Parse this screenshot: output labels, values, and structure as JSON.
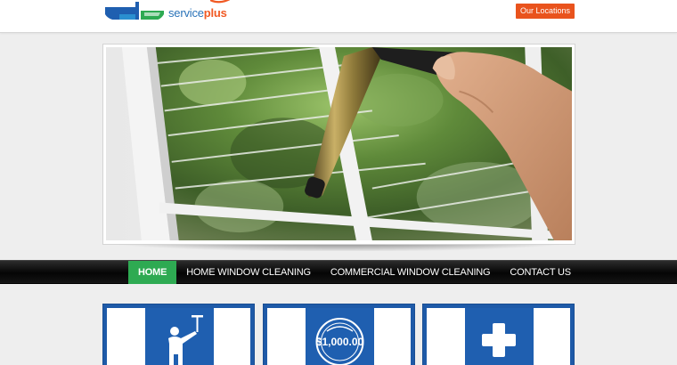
{
  "brand": {
    "name_part1": "service",
    "name_part2": "plus",
    "primary_color": "#2a73b8",
    "accent_color": "#f15a24",
    "green_color": "#2eaa52"
  },
  "header": {
    "locations_button": "Our Locations"
  },
  "hero": {
    "image": "window-cleaning-squeegee-photo"
  },
  "nav": {
    "items": [
      {
        "label": "HOME",
        "active": true
      },
      {
        "label": "HOME WINDOW CLEANING",
        "active": false
      },
      {
        "label": "COMMERCIAL WINDOW CLEANING",
        "active": false
      },
      {
        "label": "CONTACT US",
        "active": false
      }
    ]
  },
  "cards": [
    {
      "icon": "window-cleaner-icon"
    },
    {
      "icon": "guarantee-badge-icon",
      "badge_amount": "$1,000.00"
    },
    {
      "icon": "plus-cross-icon"
    }
  ]
}
